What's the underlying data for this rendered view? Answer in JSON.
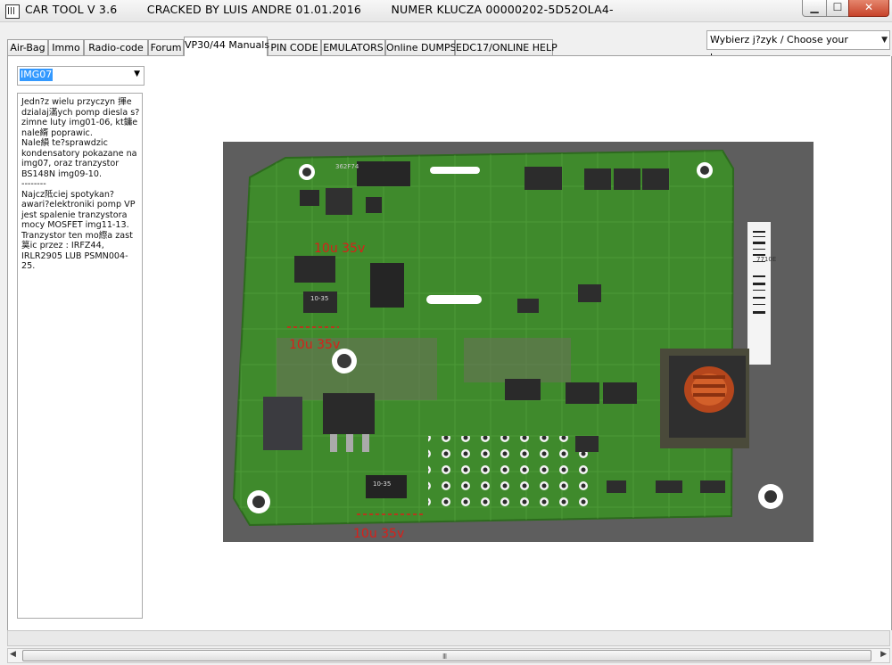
{
  "window": {
    "title": "CAR TOOL V 3.6        CRACKED BY LUIS ANDRE 01.01.2016        NUMER KLUCZA 00000202-5D52OLA4-",
    "controls": {
      "minimize": "▁",
      "maximize": "☐",
      "close": "✕"
    }
  },
  "tabs": [
    {
      "label": "Air-Bag"
    },
    {
      "label": "Immo"
    },
    {
      "label": "Radio-code"
    },
    {
      "label": "Forum"
    },
    {
      "label": "VP30/44 Manuals",
      "active": true
    },
    {
      "label": "PIN CODE"
    },
    {
      "label": "EMULATORS"
    },
    {
      "label": "Online DUMPS"
    },
    {
      "label": "EDC17/ONLINE HELP"
    }
  ],
  "language": {
    "value": "Wybierz j?zyk / Choose your language"
  },
  "image_select": {
    "value": "IMG07"
  },
  "description": "Jedn?z wielu przyczyn 揮e dzialaj滿ych pomp diesla s?zimne luty img01-06, kt鏞e nale縃 poprawic.\nNale縜 te?sprawdzic kondensatory pokazane na img07, oraz tranzystor BS148N img09-10.\n--------\nNajcz阺ciej spotykan?awari?elektroniki pomp VP jest spalenie tranzystora mocy MOSFET img11-13.\nTranzystor ten mo縩a zast筽ic przez : IRFZ44, IRLR2905 LUB PSMN004-25.",
  "photo": {
    "annotations": [
      {
        "text": "10u 35v"
      },
      {
        "text": "10u 35v"
      },
      {
        "text": "10u 35v"
      }
    ],
    "chip_marks": [
      "10-35",
      "10-35",
      "10-35",
      "362F74",
      "7710E"
    ]
  },
  "colors": {
    "pcb": "#3f8a2c",
    "annotation": "#d8201a",
    "selection": "#3399ff"
  }
}
